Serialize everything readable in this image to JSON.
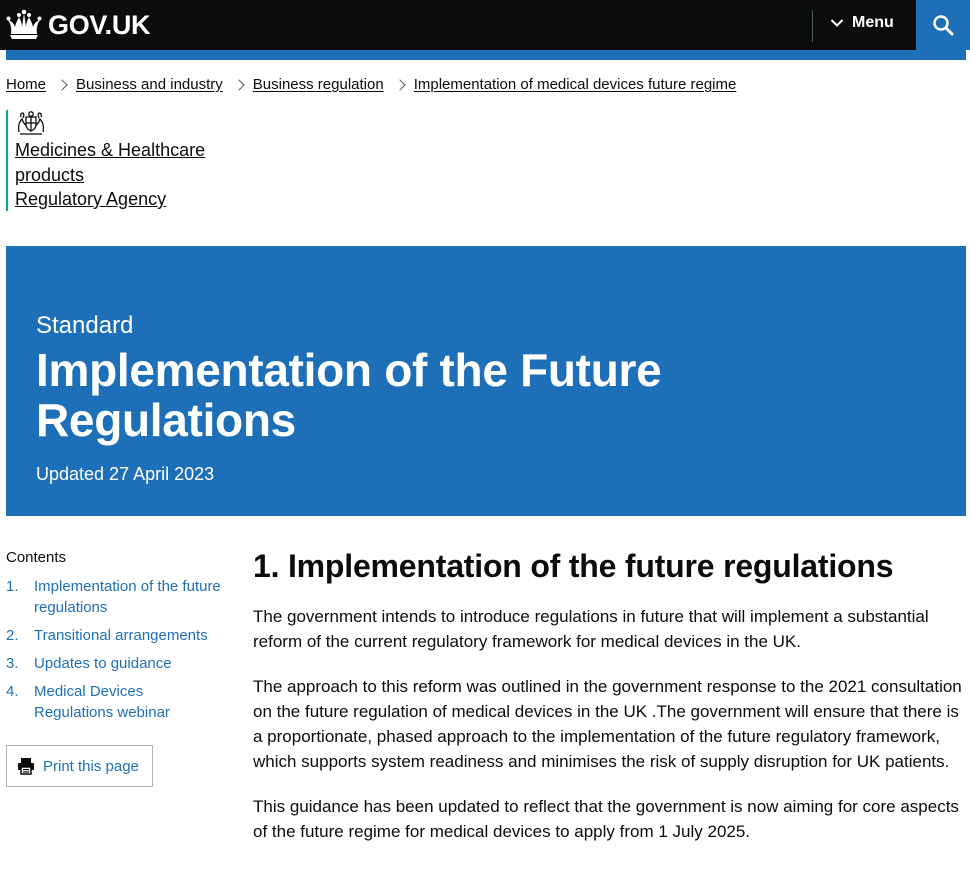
{
  "header": {
    "logo_text": "GOV.UK",
    "menu_label": "Menu"
  },
  "breadcrumb": [
    "Home",
    "Business and industry",
    "Business regulation",
    "Implementation of medical devices future regime"
  ],
  "organisation": {
    "name_line1": "Medicines & Healthcare",
    "name_line2": "products",
    "name_line3": "Regulatory Agency"
  },
  "hero": {
    "document_type": "Standard",
    "title": "Implementation of the Future Regulations",
    "updated": "Updated 27 April 2023"
  },
  "contents": {
    "title": "Contents",
    "items": [
      {
        "num": "1.",
        "label": "Implementation of the future regulations"
      },
      {
        "num": "2.",
        "label": "Transitional arrangements"
      },
      {
        "num": "3.",
        "label": "Updates to guidance"
      },
      {
        "num": "4.",
        "label": "Medical Devices Regulations webinar"
      }
    ],
    "print_label": "Print this page"
  },
  "main": {
    "heading": "1. Implementation of the future regulations",
    "paragraphs": [
      "The government intends to introduce regulations in future that will implement a substantial reform of the current regulatory framework for medical devices in the UK.",
      "The approach to this reform was outlined in the government response to the 2021 consultation on the future regulation of medical devices in the UK .The government will ensure that there is a proportionate, phased approach to the implementation of the future regulatory framework, which supports system readiness and minimises the risk of supply disruption for UK patients.",
      "This guidance has been updated to reflect that the government is now aiming for core aspects of the future regime for medical devices to apply from 1 July 2025."
    ]
  },
  "colors": {
    "header_bg": "#0b0c0c",
    "brand_blue": "#1d70b8",
    "org_accent": "#00ad93",
    "text": "#0b0c0c"
  },
  "icons": {
    "logo": "crown-icon",
    "menu": "chevron-down-icon",
    "search": "search-icon",
    "org": "royal-coat-of-arms-icon",
    "print": "printer-icon"
  }
}
